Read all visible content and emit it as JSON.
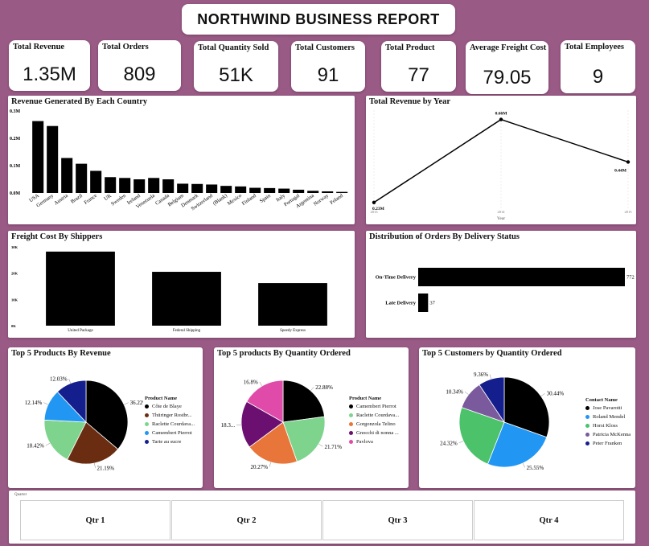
{
  "report_title": "NORTHWIND BUSINESS REPORT",
  "kpis": [
    {
      "label": "Total Revenue",
      "value": "1.35M"
    },
    {
      "label": "Total Orders",
      "value": "809"
    },
    {
      "label": "Total Quantity Sold",
      "value": "51K"
    },
    {
      "label": "Total Customers",
      "value": "91"
    },
    {
      "label": "Total Product",
      "value": "77"
    },
    {
      "label": "Average Freight Cost",
      "value": "79.05"
    },
    {
      "label": "Total Employees",
      "value": "9"
    }
  ],
  "chart_data": [
    {
      "id": "country",
      "type": "bar",
      "title": "Revenue Generated By Each Country",
      "categories": [
        "USA",
        "Germany",
        "Austria",
        "Brazil",
        "France",
        "UK",
        "Sweden",
        "Ireland",
        "Venezuela",
        "Canada",
        "Belgium",
        "Denmark",
        "Switzerland",
        "(Blank)",
        "Mexico",
        "Finland",
        "Spain",
        "Italy",
        "Portugal",
        "Argentina",
        "Norway",
        "Poland"
      ],
      "values": [
        0.263,
        0.245,
        0.128,
        0.107,
        0.081,
        0.058,
        0.055,
        0.05,
        0.055,
        0.05,
        0.034,
        0.033,
        0.031,
        0.026,
        0.024,
        0.019,
        0.018,
        0.016,
        0.012,
        0.008,
        0.006,
        0.004
      ],
      "y_ticks": [
        "0.0M",
        "0.1M",
        "0.2M",
        "0.3M"
      ],
      "ylim": [
        0,
        0.3
      ],
      "bar_color": "#000000"
    },
    {
      "id": "year",
      "type": "line",
      "title": "Total Revenue by Year",
      "x": [
        "2013",
        "2014",
        "2015"
      ],
      "values": [
        0.23,
        0.66,
        0.44
      ],
      "labels": [
        "0.23M",
        "0.66M",
        "0.44M"
      ],
      "xlabel": "Year",
      "ylim": [
        0.2,
        0.7
      ],
      "line_color": "#000000"
    },
    {
      "id": "shippers",
      "type": "bar",
      "title": "Freight Cost By Shippers",
      "categories": [
        "United Package",
        "Federal Shipping",
        "Speedy Express"
      ],
      "values": [
        28200,
        20500,
        16200
      ],
      "y_ticks": [
        "0K",
        "10K",
        "20K",
        "30K"
      ],
      "ylim": [
        0,
        30000
      ],
      "bar_color": "#000000"
    },
    {
      "id": "delivery",
      "type": "bar",
      "orientation": "horizontal",
      "title": "Distribution of Orders By Delivery Status",
      "categories": [
        "On-Time Delivery",
        "Late Delivery"
      ],
      "values": [
        772,
        37
      ],
      "value_labels": [
        "772",
        "37"
      ],
      "xlim": [
        0,
        772
      ],
      "bar_color": "#000000"
    },
    {
      "id": "top-products-revenue",
      "type": "pie",
      "title": "Top 5 Products By Revenue",
      "legend_title": "Product Name",
      "slices": [
        {
          "name": "Côte de Blaye",
          "value": 36.22,
          "label": "36.22%",
          "color": "#000000"
        },
        {
          "name": "Thüringer Rostbr...",
          "value": 21.19,
          "label": "21.19%",
          "color": "#6b2d12"
        },
        {
          "name": "Raclette Courdava...",
          "value": 18.42,
          "label": "18.42%",
          "color": "#7fd48d"
        },
        {
          "name": "Camembert Pierrot",
          "value": 12.14,
          "label": "12.14%",
          "color": "#2196f3"
        },
        {
          "name": "Tarte au sucre",
          "value": 12.03,
          "label": "12.03%",
          "color": "#141e8c"
        }
      ]
    },
    {
      "id": "top-products-quantity",
      "type": "pie",
      "title": "Top 5 products By Quantity Ordered",
      "legend_title": "Product Name",
      "slices": [
        {
          "name": "Camembert Pierrot",
          "value": 22.88,
          "label": "22.88%",
          "color": "#000000"
        },
        {
          "name": "Raclette Courdava...",
          "value": 21.71,
          "label": "21.71%",
          "color": "#7fd48d"
        },
        {
          "name": "Gorgonzola Telino",
          "value": 20.27,
          "label": "20.27%",
          "color": "#e8763a"
        },
        {
          "name": "Gnocchi di nonna ...",
          "value": 18.34,
          "label": "18.3...",
          "color": "#6b0f70"
        },
        {
          "name": "Pavlova",
          "value": 16.8,
          "label": "16.8%",
          "color": "#e04aa8"
        }
      ]
    },
    {
      "id": "top-customers",
      "type": "pie",
      "title": "Top 5 Customers by Quantity Ordered",
      "legend_title": "Contact Name",
      "slices": [
        {
          "name": "Jose Pavarotti",
          "value": 30.44,
          "label": "30.44%",
          "color": "#000000"
        },
        {
          "name": "Roland Mendel",
          "value": 25.55,
          "label": "25.55%",
          "color": "#2196f3"
        },
        {
          "name": "Horst Kloss",
          "value": 24.32,
          "label": "24.32%",
          "color": "#4cc26a"
        },
        {
          "name": "Patricia McKenna",
          "value": 10.34,
          "label": "10.34%",
          "color": "#7a5a9c"
        },
        {
          "name": "Peter Franken",
          "value": 9.36,
          "label": "9.36%",
          "color": "#141e8c"
        }
      ]
    }
  ],
  "slicer": {
    "label": "Quarter",
    "options": [
      "Qtr 1",
      "Qtr 2",
      "Qtr 3",
      "Qtr 4"
    ]
  }
}
